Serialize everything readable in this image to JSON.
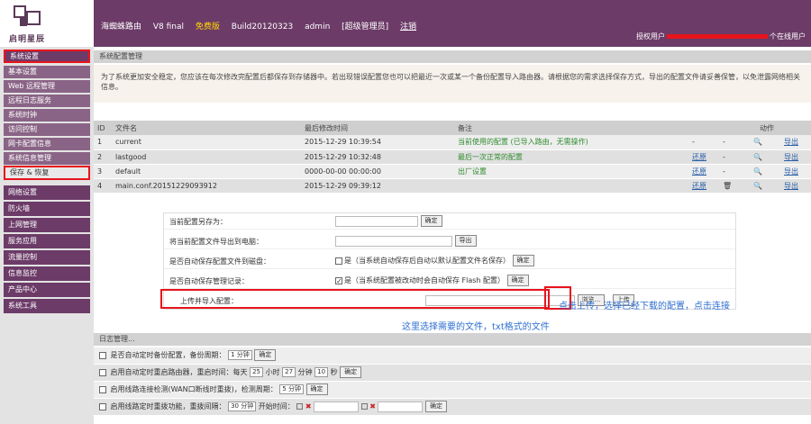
{
  "header": {
    "brand": "启明星辰",
    "product": "海蜘蛛路由",
    "version_label": "V8 final",
    "version_tag": "免费版",
    "build": "Build20120323",
    "user": "admin",
    "role": "[超级管理员]",
    "logout": "注销",
    "online_prefix": "授权用户",
    "online_suffix": "个在线用户"
  },
  "sidebar": {
    "top_item": "系统设置",
    "sub_items": [
      "基本设置",
      "Web 远程管理",
      "远程日志服务",
      "系统时钟",
      "访问控制",
      "网卡配置信息",
      "系统信息管理",
      "保存 & 恢复"
    ],
    "main_items": [
      "网络设置",
      "防火墙",
      "上网管理",
      "服务应用",
      "流量控制",
      "信息监控",
      "产品中心",
      "系统工具"
    ]
  },
  "section_title": "系统配置管理",
  "description": "为了系统更加安全稳定，您应该在每次修改完配置后都保存到存储器中。若出现错误配置您也可以把最近一次或某一个备份配置导入路由器。请根据您的需求选择保存方式，导出的配置文件请妥善保管，以免泄露网络相关信息。",
  "table": {
    "headers": [
      "ID",
      "文件名",
      "最后修改时间",
      "备注",
      "",
      "",
      "动作",
      ""
    ],
    "rows": [
      {
        "id": "1",
        "name": "current",
        "time": "2015-12-29 10:39:54",
        "note": "当前使用的配置",
        "note2": "(已导入路由，无需操作)",
        "c1": "-",
        "c2": "-",
        "c3": "🔍",
        "c4": "导出"
      },
      {
        "id": "2",
        "name": "lastgood",
        "time": "2015-12-29 10:32:48",
        "note": "最后一次正常的配置",
        "note2": "",
        "c1": "还原",
        "c2": "-",
        "c3": "🔍",
        "c4": "导出"
      },
      {
        "id": "3",
        "name": "default",
        "time": "0000-00-00 00:00:00",
        "note": "出厂设置",
        "note2": "",
        "c1": "还原",
        "c2": "-",
        "c3": "🔍",
        "c4": "导出"
      },
      {
        "id": "4",
        "name": "main.conf.20151229093912",
        "time": "2015-12-29 09:39:12",
        "note": "",
        "note2": "",
        "c1": "还原",
        "c2": "🗑",
        "c3": "🔍",
        "c4": "导出"
      }
    ]
  },
  "form": {
    "row1_label": "当前配置另存为：",
    "row1_btn": "确定",
    "row2_label": "将当前配置文件导出到电脑：",
    "row2_btn": "导出",
    "row3_label": "是否自动保存配置文件到磁盘：",
    "row3_text": "是（当系统自动保存后自动以默认配置文件名保存）",
    "row3_btn": "确定",
    "row4_label": "是否自动保存管理记录：",
    "row4_text": "是（当系统配置被改动时会自动保存 Flash 配置）",
    "row4_btn": "确定",
    "row5_label": "上传并导入配置：",
    "browse_btn": "浏览...",
    "upload_btn": "上传"
  },
  "annotations": {
    "upload_hint": "点击上传，选择已经下载的配置，点击连接",
    "file_hint": "这里选择需要的文件，txt格式的文件"
  },
  "lower_title": "日志管理...",
  "lower_rows": [
    {
      "label": "是否自动定时备份配置，备份周期：",
      "sel1": "1 分钟",
      "btn": "确定"
    },
    {
      "label": "启用自动定时重启路由器，重启时间：每天",
      "sel1": "25",
      "mid1": "小时",
      "sel2": "27",
      "mid2": "分钟",
      "sel3": "10",
      "mid3": "秒",
      "btn": "确定"
    },
    {
      "label": "启用线路连接检测(WAN口断线时重拨)，检测周期：",
      "sel1": "5 分钟",
      "btn": "确定"
    },
    {
      "label": "启用线路定时重拨功能，重拨间隔：",
      "sel1": "30 分钟",
      "mid1": "开始时间：",
      "btn": "确定"
    }
  ]
}
